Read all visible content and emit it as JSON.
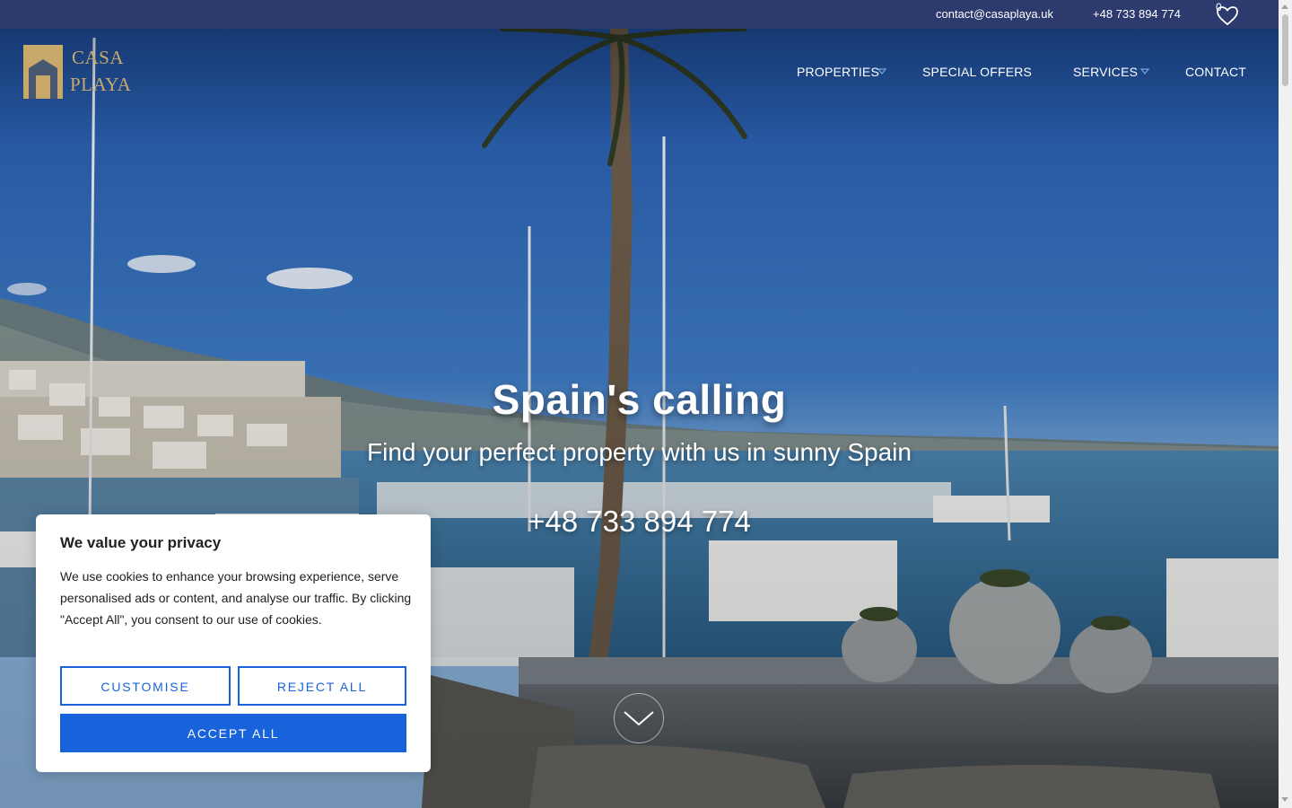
{
  "topbar": {
    "email": "contact@casaplaya.uk",
    "phone": "+48 733 894 774",
    "favorites_count": "0",
    "background": "#2c3a6e"
  },
  "logo": {
    "line1": "CASA",
    "line2": "PLAYA",
    "color": "#c9a96a"
  },
  "nav": {
    "items": [
      {
        "label": "PROPERTIES",
        "has_dropdown": true
      },
      {
        "label": "SPECIAL OFFERS",
        "has_dropdown": false
      },
      {
        "label": "SERVICES",
        "has_dropdown": true
      },
      {
        "label": "CONTACT",
        "has_dropdown": false
      }
    ]
  },
  "hero": {
    "title": "Spain's calling",
    "subtitle": "Find your perfect property with us in sunny Spain",
    "phone": "+48 733 894 774"
  },
  "cookie_banner": {
    "title": "We value your privacy",
    "body": "We use cookies to enhance your browsing experience, serve personalised ads or content, and analyse our traffic. By clicking \"Accept All\", you consent to our use of cookies.",
    "customise_label": "CUSTOMISE",
    "reject_label": "REJECT ALL",
    "accept_label": "ACCEPT ALL",
    "accent": "#1863dc"
  },
  "icons": {
    "favorites": "heart-icon",
    "dropdown": "chevron-down-icon",
    "scroll": "chevron-down-icon"
  }
}
